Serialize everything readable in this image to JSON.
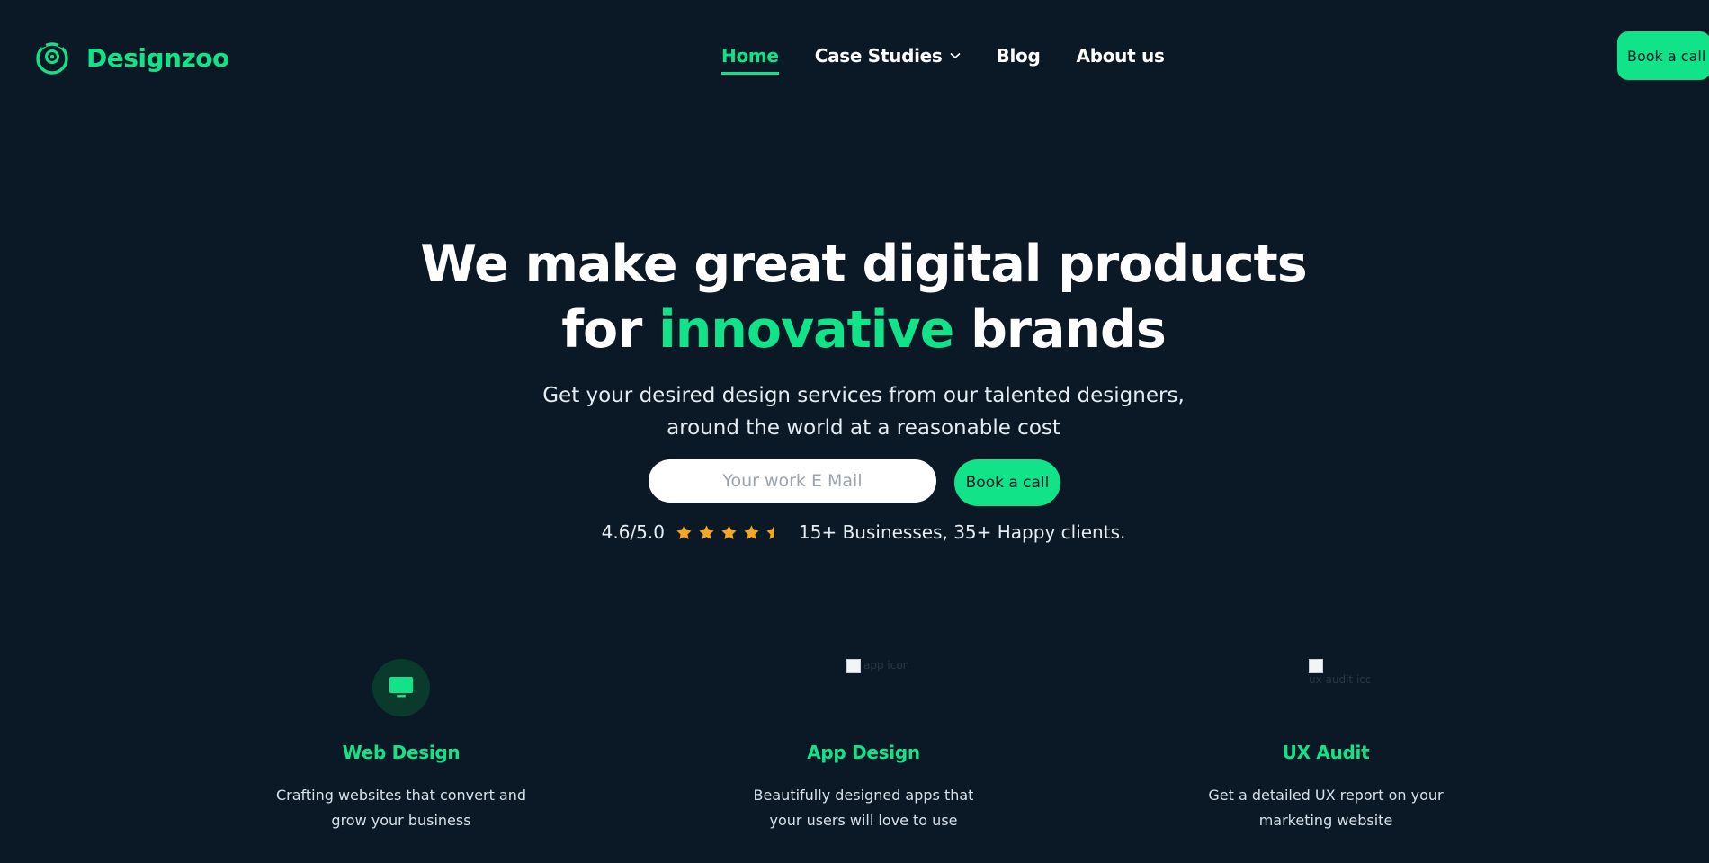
{
  "colors": {
    "background": "#0b1825",
    "accent": "#11e389",
    "text": "#ffffff",
    "star": "#f5a623"
  },
  "header": {
    "brand_name": "Designzoo",
    "logo_icon": "smiley-circle-icon",
    "nav": [
      {
        "label": "Home",
        "active": true
      },
      {
        "label": "Case Studies",
        "has_dropdown": true
      },
      {
        "label": "Blog"
      },
      {
        "label": "About us"
      }
    ],
    "cta_label": "Book a call"
  },
  "hero": {
    "title_line1": "We make great digital products",
    "title_line2_pre": "for ",
    "title_line2_accent": "innovative",
    "title_line2_post": " brands",
    "subtitle_line1": "Get your desired design services from our talented designers,",
    "subtitle_line2": "around the world at a reasonable cost",
    "email_placeholder": "Your work E Mail",
    "cta_label": "Book a call",
    "rating_value": "4.6/5.0",
    "rating_stars": 4.5,
    "rating_text": "15+ Businesses, 35+ Happy clients."
  },
  "services": [
    {
      "title": "Web Design",
      "icon": "monitor-icon",
      "description": "Crafting websites that convert and grow your business"
    },
    {
      "title": "App Design",
      "icon": "broken-image-icon",
      "icon_alt": "app icon",
      "description": "Beautifully designed apps that your users will love to use"
    },
    {
      "title": "UX Audit",
      "icon": "broken-image-icon",
      "icon_alt": "ux audit icon",
      "description": "Get a detailed UX report on your marketing website"
    }
  ]
}
